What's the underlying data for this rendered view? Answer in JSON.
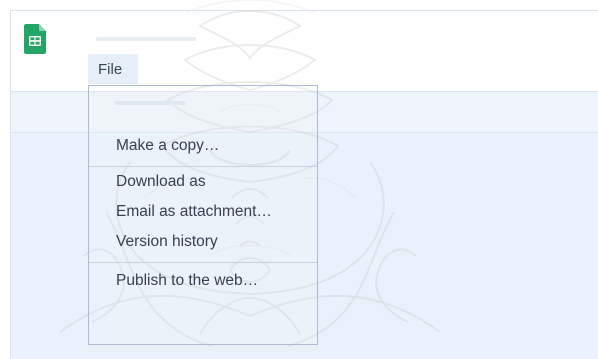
{
  "menu_bar": {
    "file_label": "File"
  },
  "file_menu": {
    "items": [
      {
        "label": "Make a copy…"
      },
      {
        "label": "Download as"
      },
      {
        "label": "Email as attachment…"
      },
      {
        "label": "Version history"
      },
      {
        "label": "Publish to the web…"
      }
    ]
  },
  "icons": {
    "app_logo": "google-sheets-icon"
  },
  "colors": {
    "sheets_green": "#23a566",
    "menu_border": "#aebbd7",
    "menu_text": "#36414f",
    "toolbar_background": "#eef4fb"
  }
}
